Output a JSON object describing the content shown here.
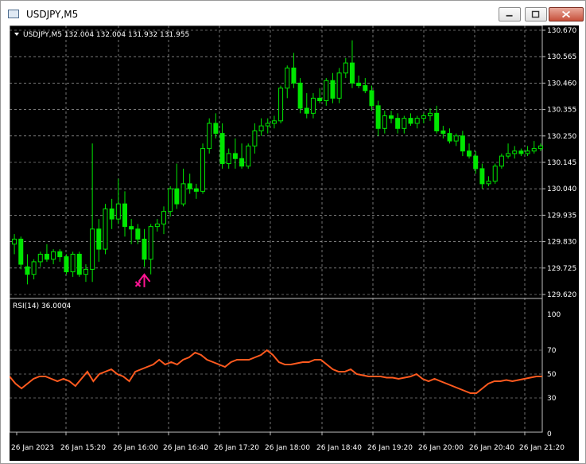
{
  "window": {
    "title": "USDJPY,M5",
    "buttons": {
      "minimize": "minimize-icon",
      "maximize": "maximize-icon",
      "close": "close-icon"
    }
  },
  "chart": {
    "info": "USDJPY,M5  132.004 132.004 131.932 131.955",
    "price_ticks": [
      "130.670",
      "130.565",
      "130.460",
      "130.355",
      "130.250",
      "130.145",
      "130.040",
      "129.935",
      "129.830",
      "129.725",
      "129.620"
    ],
    "rsi_label": "RSI(14) 36.0004",
    "rsi_ticks": [
      "100",
      "70",
      "50",
      "30",
      "0"
    ],
    "time_ticks": [
      "26 Jan 2023",
      "26 Jan 15:20",
      "26 Jan 16:00",
      "26 Jan 16:40",
      "26 Jan 17:20",
      "26 Jan 18:00",
      "26 Jan 18:40",
      "26 Jan 19:20",
      "26 Jan 20:00",
      "26 Jan 20:40",
      "26 Jan 21:20"
    ],
    "colors": {
      "background": "#000000",
      "grid": "#c0c0c0",
      "candle": "#00e600",
      "rsi_line": "#ff5a1f",
      "arrow": "#ff1493",
      "text": "#ffffff"
    }
  },
  "chart_data": [
    {
      "type": "candlestick",
      "title": "USDJPY,M5",
      "ylim": [
        129.62,
        130.67
      ],
      "candles": [
        [
          129.82,
          129.86,
          129.78,
          129.84
        ],
        [
          129.84,
          129.85,
          129.72,
          129.74
        ],
        [
          129.73,
          129.78,
          129.66,
          129.7
        ],
        [
          129.7,
          129.76,
          129.68,
          129.75
        ],
        [
          129.75,
          129.79,
          129.73,
          129.78
        ],
        [
          129.78,
          129.82,
          129.75,
          129.76
        ],
        [
          129.76,
          129.8,
          129.74,
          129.79
        ],
        [
          129.79,
          129.8,
          129.75,
          129.77
        ],
        [
          129.77,
          129.78,
          129.7,
          129.71
        ],
        [
          129.71,
          129.79,
          129.69,
          129.78
        ],
        [
          129.78,
          129.79,
          129.69,
          129.7
        ],
        [
          129.7,
          129.74,
          129.67,
          129.72
        ],
        [
          129.72,
          130.22,
          129.67,
          129.88
        ],
        [
          129.88,
          129.92,
          129.75,
          129.8
        ],
        [
          129.8,
          129.98,
          129.78,
          129.96
        ],
        [
          129.96,
          130.0,
          129.88,
          129.92
        ],
        [
          129.92,
          130.08,
          129.9,
          129.98
        ],
        [
          129.98,
          130.03,
          129.85,
          129.89
        ],
        [
          129.89,
          129.92,
          129.82,
          129.88
        ],
        [
          129.88,
          129.9,
          129.82,
          129.84
        ],
        [
          129.84,
          129.88,
          129.73,
          129.76
        ],
        [
          129.76,
          129.9,
          129.7,
          129.89
        ],
        [
          129.89,
          129.92,
          129.87,
          129.9
        ],
        [
          129.9,
          129.97,
          129.86,
          129.95
        ],
        [
          129.95,
          130.05,
          129.93,
          130.04
        ],
        [
          130.04,
          130.14,
          129.96,
          129.98
        ],
        [
          129.98,
          130.12,
          129.97,
          130.06
        ],
        [
          130.06,
          130.1,
          130.02,
          130.04
        ],
        [
          130.04,
          130.06,
          130.0,
          130.03
        ],
        [
          130.03,
          130.22,
          130.02,
          130.2
        ],
        [
          130.2,
          130.32,
          130.18,
          130.3
        ],
        [
          130.3,
          130.34,
          130.24,
          130.26
        ],
        [
          130.26,
          130.3,
          130.12,
          130.14
        ],
        [
          130.14,
          130.2,
          130.12,
          130.18
        ],
        [
          130.18,
          130.24,
          130.12,
          130.16
        ],
        [
          130.16,
          130.22,
          130.12,
          130.13
        ],
        [
          130.13,
          130.22,
          130.12,
          130.21
        ],
        [
          130.21,
          130.3,
          130.18,
          130.27
        ],
        [
          130.27,
          130.32,
          130.25,
          130.29
        ],
        [
          130.29,
          130.32,
          130.26,
          130.3
        ],
        [
          130.3,
          130.33,
          130.28,
          130.31
        ],
        [
          130.31,
          130.45,
          130.3,
          130.44
        ],
        [
          130.44,
          130.53,
          130.4,
          130.52
        ],
        [
          130.52,
          130.58,
          130.44,
          130.46
        ],
        [
          130.46,
          130.48,
          130.34,
          130.36
        ],
        [
          130.36,
          130.42,
          130.32,
          130.34
        ],
        [
          130.34,
          130.42,
          130.32,
          130.4
        ],
        [
          130.4,
          130.44,
          130.38,
          130.39
        ],
        [
          130.39,
          130.48,
          130.37,
          130.47
        ],
        [
          130.47,
          130.5,
          130.38,
          130.4
        ],
        [
          130.4,
          130.52,
          130.38,
          130.5
        ],
        [
          130.5,
          130.56,
          130.48,
          130.54
        ],
        [
          130.54,
          130.63,
          130.44,
          130.46
        ],
        [
          130.46,
          130.49,
          130.44,
          130.45
        ],
        [
          130.45,
          130.48,
          130.42,
          130.43
        ],
        [
          130.43,
          130.45,
          130.35,
          130.37
        ],
        [
          130.37,
          130.39,
          130.25,
          130.28
        ],
        [
          130.28,
          130.35,
          130.26,
          130.33
        ],
        [
          130.33,
          130.35,
          130.3,
          130.32
        ],
        [
          130.32,
          130.34,
          130.26,
          130.28
        ],
        [
          130.28,
          130.33,
          130.26,
          130.32
        ],
        [
          130.32,
          130.34,
          130.29,
          130.3
        ],
        [
          130.3,
          130.33,
          130.28,
          130.32
        ],
        [
          130.32,
          130.34,
          130.3,
          130.33
        ],
        [
          130.33,
          130.36,
          130.31,
          130.34
        ],
        [
          130.34,
          130.37,
          130.26,
          130.27
        ],
        [
          130.27,
          130.29,
          130.24,
          130.26
        ],
        [
          130.26,
          130.28,
          130.22,
          130.23
        ],
        [
          130.23,
          130.26,
          130.21,
          130.25
        ],
        [
          130.25,
          130.27,
          130.17,
          130.19
        ],
        [
          130.19,
          130.22,
          130.16,
          130.17
        ],
        [
          130.17,
          130.19,
          130.1,
          130.12
        ],
        [
          130.12,
          130.14,
          130.04,
          130.06
        ],
        [
          130.06,
          130.09,
          130.05,
          130.07
        ],
        [
          130.07,
          130.14,
          130.06,
          130.13
        ],
        [
          130.13,
          130.18,
          130.12,
          130.17
        ],
        [
          130.17,
          130.22,
          130.16,
          130.18
        ],
        [
          130.18,
          130.21,
          130.16,
          130.19
        ],
        [
          130.19,
          130.2,
          130.17,
          130.18
        ],
        [
          130.18,
          130.21,
          130.17,
          130.19
        ],
        [
          130.19,
          130.23,
          130.18,
          130.2
        ],
        [
          130.2,
          130.22,
          130.19,
          130.21
        ]
      ],
      "signal_arrow": {
        "candle_index": 20,
        "price": 129.69
      }
    },
    {
      "type": "line",
      "title": "RSI(14) 36.0004",
      "ylim": [
        0,
        100
      ],
      "series": [
        {
          "values": [
            48,
            42,
            38,
            42,
            46,
            48,
            48,
            46,
            44,
            46,
            44,
            40,
            46,
            52,
            44,
            50,
            52,
            54,
            50,
            48,
            44,
            52,
            54,
            56,
            58,
            62,
            58,
            60,
            58,
            62,
            64,
            68,
            66,
            62,
            60,
            58,
            56,
            60,
            62,
            62,
            62,
            64,
            66,
            70,
            66,
            60,
            58,
            58,
            59,
            60,
            60,
            62,
            62,
            58,
            54,
            52,
            52,
            54,
            50,
            49,
            48,
            48,
            48,
            47,
            47,
            46,
            47,
            48,
            50,
            46,
            44,
            46,
            44,
            42,
            40,
            38,
            36,
            34,
            34,
            38,
            42,
            44,
            44,
            45,
            44,
            45,
            46,
            47,
            48,
            48
          ]
        }
      ]
    }
  ]
}
